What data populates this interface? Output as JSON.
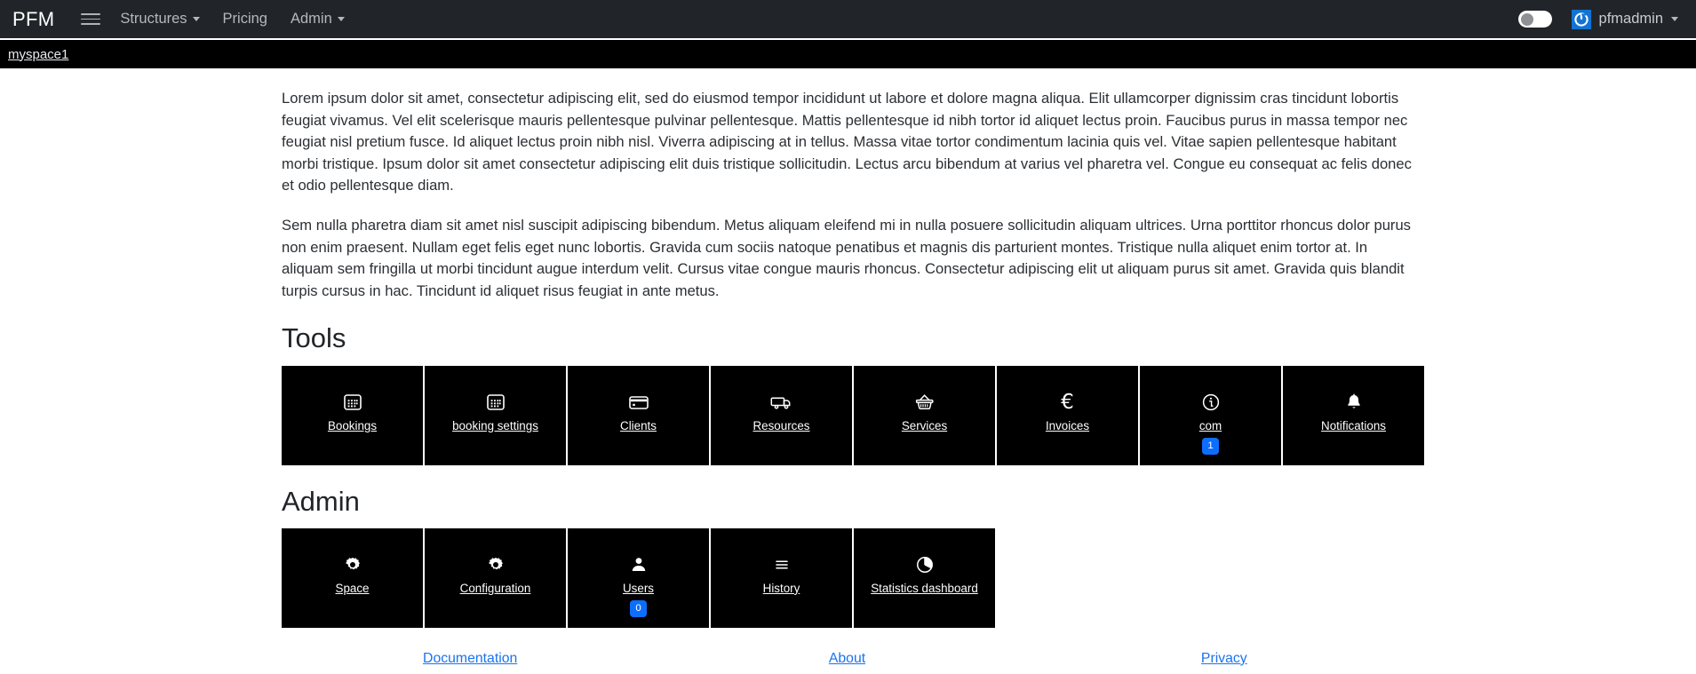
{
  "navbar": {
    "brand": "PFM",
    "menu_icon": "hamburger-icon",
    "links": [
      {
        "label": "Structures",
        "has_caret": true
      },
      {
        "label": "Pricing",
        "has_caret": false
      },
      {
        "label": "Admin",
        "has_caret": true
      }
    ],
    "theme_toggle": {
      "state": "off"
    },
    "user": {
      "name": "pfmadmin",
      "logo_icon": "power-circle-icon",
      "caret": true
    }
  },
  "breadcrumb": {
    "current": "myspace1"
  },
  "main": {
    "paragraphs": [
      "Lorem ipsum dolor sit amet, consectetur adipiscing elit, sed do eiusmod tempor incididunt ut labore et dolore magna aliqua. Elit ullamcorper dignissim cras tincidunt lobortis feugiat vivamus. Vel elit scelerisque mauris pellentesque pulvinar pellentesque. Mattis pellentesque id nibh tortor id aliquet lectus proin. Faucibus purus in massa tempor nec feugiat nisl pretium fusce. Id aliquet lectus proin nibh nisl. Viverra adipiscing at in tellus. Massa vitae tortor condimentum lacinia quis vel. Vitae sapien pellentesque habitant morbi tristique. Ipsum dolor sit amet consectetur adipiscing elit duis tristique sollicitudin. Lectus arcu bibendum at varius vel pharetra vel. Congue eu consequat ac felis donec et odio pellentesque diam.",
      "Sem nulla pharetra diam sit amet nisl suscipit adipiscing bibendum. Metus aliquam eleifend mi in nulla posuere sollicitudin aliquam ultrices. Urna porttitor rhoncus dolor purus non enim praesent. Nullam eget felis eget nunc lobortis. Gravida cum sociis natoque penatibus et magnis dis parturient montes. Tristique nulla aliquet enim tortor at. In aliquam sem fringilla ut morbi tincidunt augue interdum velit. Cursus vitae congue mauris rhoncus. Consectetur adipiscing elit ut aliquam purus sit amet. Gravida quis blandit turpis cursus in hac. Tincidunt id aliquet risus feugiat in ante metus."
    ],
    "tools": {
      "title": "Tools",
      "tiles": [
        {
          "label": "Bookings",
          "icon": "calendar-icon",
          "badge": null
        },
        {
          "label": "booking settings",
          "icon": "calendar-icon",
          "badge": null
        },
        {
          "label": "Clients",
          "icon": "credit-card-icon",
          "badge": null
        },
        {
          "label": "Resources",
          "icon": "truck-icon",
          "badge": null
        },
        {
          "label": "Services",
          "icon": "basket-icon",
          "badge": null
        },
        {
          "label": "Invoices",
          "icon": "euro-icon",
          "badge": null
        },
        {
          "label": "com",
          "icon": "info-circle-icon",
          "badge": "1"
        },
        {
          "label": "Notifications",
          "icon": "bell-icon",
          "badge": null
        }
      ]
    },
    "admin": {
      "title": "Admin",
      "tiles": [
        {
          "label": "Space",
          "icon": "gear-icon",
          "badge": null
        },
        {
          "label": "Configuration",
          "icon": "gear-icon",
          "badge": null
        },
        {
          "label": "Users",
          "icon": "person-icon",
          "badge": "0"
        },
        {
          "label": "History",
          "icon": "list-icon",
          "badge": null
        },
        {
          "label": "Statistics dashboard",
          "icon": "pie-chart-icon",
          "badge": null
        }
      ]
    }
  },
  "footer": {
    "links": [
      {
        "label": "Documentation"
      },
      {
        "label": "About"
      },
      {
        "label": "Privacy"
      }
    ]
  },
  "colors": {
    "navbar_bg": "#212529",
    "breadcrumb_bg": "#000000",
    "tile_bg": "#000000",
    "badge_blue": "#0d6efd",
    "link_blue": "#1a73f0",
    "brand_blue": "#1273d4"
  }
}
